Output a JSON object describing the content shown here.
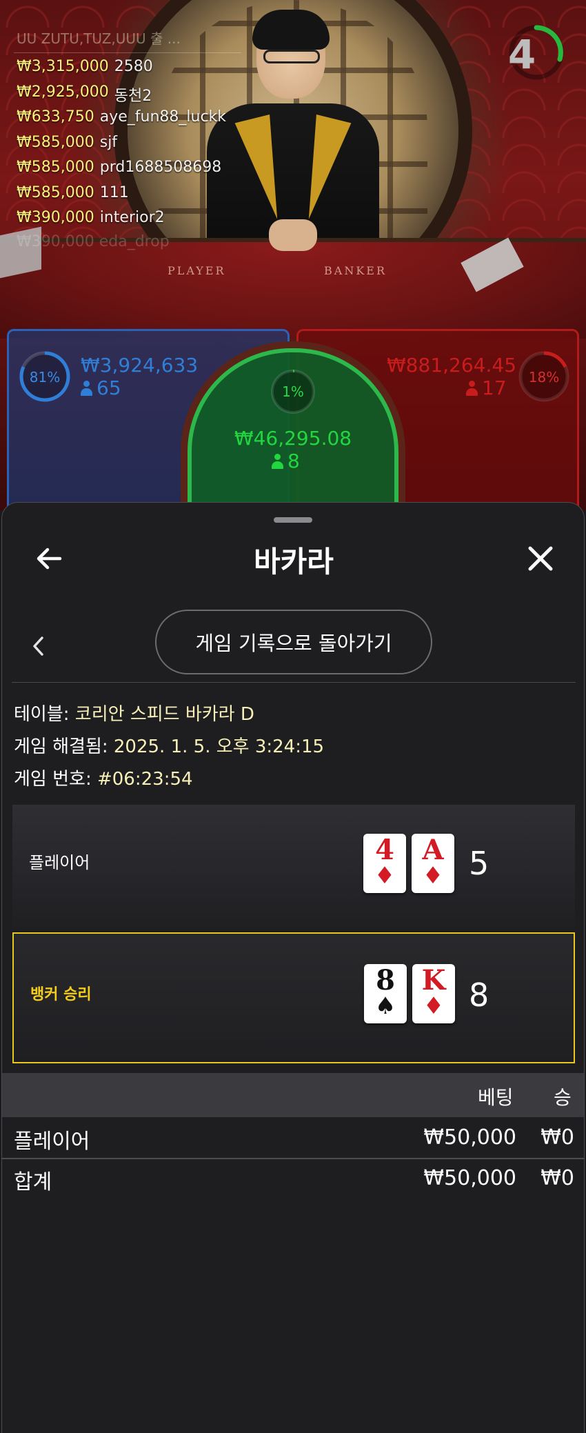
{
  "video": {
    "felt_player": "PLAYER",
    "felt_banker": "BANKER",
    "timer": "4",
    "leaderboard": {
      "partial_row": "UU ZUTU,TUZ,UUU 출 ...",
      "rows": [
        {
          "amount": "₩3,315,000",
          "name": "2580"
        },
        {
          "amount": "₩2,925,000",
          "name": "동천2"
        },
        {
          "amount": "₩633,750",
          "name": "aye_fun88_luckk"
        },
        {
          "amount": "₩585,000",
          "name": "sjf"
        },
        {
          "amount": "₩585,000",
          "name": "prd1688508698"
        },
        {
          "amount": "₩585,000",
          "name": "111"
        },
        {
          "amount": "₩390,000",
          "name": "interior2"
        }
      ],
      "faded_row": "₩390,000 eda_drop"
    },
    "player_panel": {
      "percent": "81%",
      "amount": "₩3,924,633",
      "count": "65",
      "color": "#2f7fd8"
    },
    "banker_panel": {
      "percent": "18%",
      "amount": "₩881,264.45",
      "count": "17",
      "color": "#c91d1d"
    },
    "tie_panel": {
      "percent": "1%",
      "amount": "₩46,295.08",
      "count": "8",
      "color": "#27c340"
    }
  },
  "sheet": {
    "title": "바카라",
    "history_button": "게임 기록으로 돌아가기",
    "info": {
      "table_label": "테이블: ",
      "table_value": "코리안 스피드 바카라 D",
      "resolved_label": "게임 해결됨: ",
      "resolved_value": "2025. 1. 5. 오후 3:24:15",
      "number_label": "게임 번호: ",
      "number_value": "#06:23:54"
    },
    "hands": {
      "player": {
        "label": "플레이어",
        "cards": [
          {
            "rank": "4",
            "suit": "♦"
          },
          {
            "rank": "A",
            "suit": "♦"
          }
        ],
        "score": "5"
      },
      "banker": {
        "label": "뱅커 승리",
        "label_color": "#f2cd1f",
        "cards": [
          {
            "rank": "8",
            "suit": "♠"
          },
          {
            "rank": "K",
            "suit": "♦"
          }
        ],
        "score": "8"
      }
    },
    "bets_table": {
      "col_bet": "베팅",
      "col_win": "승",
      "rows": [
        {
          "name": "플레이어",
          "bet": "₩50,000",
          "win": "₩0"
        },
        {
          "name": "합계",
          "bet": "₩50,000",
          "win": "₩0"
        }
      ]
    }
  },
  "icons": {
    "back": "back-arrow-icon",
    "close": "close-icon",
    "chevron": "chevron-left-icon",
    "person": "person-icon"
  }
}
